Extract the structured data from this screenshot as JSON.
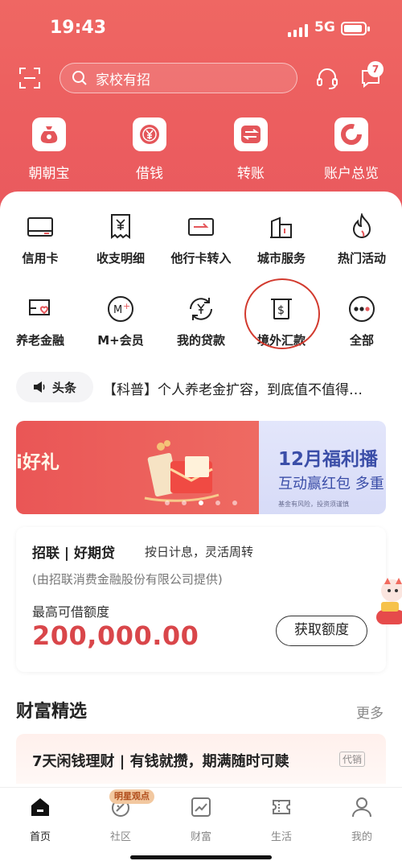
{
  "status": {
    "time": "19:43",
    "network": "5G"
  },
  "header": {
    "search_placeholder": "家校有招",
    "message_badge": "7"
  },
  "quick_actions": [
    {
      "label": "朝朝宝",
      "icon": "money-bag-icon"
    },
    {
      "label": "借钱",
      "icon": "yuan-coin-icon"
    },
    {
      "label": "转账",
      "icon": "transfer-arrows-icon"
    },
    {
      "label": "账户总览",
      "icon": "ring-chart-icon"
    }
  ],
  "services": [
    {
      "label": "信用卡",
      "icon": "credit-card-icon"
    },
    {
      "label": "收支明细",
      "icon": "receipt-icon"
    },
    {
      "label": "他行卡转入",
      "icon": "card-transfer-icon"
    },
    {
      "label": "城市服务",
      "icon": "city-building-icon"
    },
    {
      "label": "热门活动",
      "icon": "flame-icon"
    },
    {
      "label": "养老金融",
      "icon": "pension-card-icon"
    },
    {
      "label": "M+会员",
      "icon": "m-plus-icon"
    },
    {
      "label": "我的贷款",
      "icon": "loan-cycle-icon"
    },
    {
      "label": "境外汇款",
      "icon": "atm-dollar-icon"
    },
    {
      "label": "全部",
      "icon": "more-dots-icon"
    }
  ],
  "news": {
    "tag": "头条",
    "headline": "【科普】个人养老金扩容，到底值不值得…"
  },
  "banner": {
    "left_text": "i好礼",
    "right_title": "12月福利播",
    "right_sub": "互动赢红包 多重",
    "right_fine": "基金有风险，投资须谨慎",
    "active_dot": 3
  },
  "loan_card": {
    "title": "招联 | 好期贷",
    "subtitle": "按日计息，灵活周转",
    "note": "(由招联消费金融股份有限公司提供)",
    "amount_label": "最高可借额度",
    "amount": "200,000.00",
    "button": "获取额度"
  },
  "wealth": {
    "section_title": "财富精选",
    "more": "更多",
    "item_title": "7天闲钱理财 | 有钱就攒，期满随时可赎",
    "item_tag": "代销"
  },
  "tabbar": {
    "promo_pill": "明星观点",
    "tabs": [
      {
        "label": "首页",
        "icon": "home-icon"
      },
      {
        "label": "社区",
        "icon": "community-icon"
      },
      {
        "label": "财富",
        "icon": "chart-card-icon"
      },
      {
        "label": "生活",
        "icon": "ticket-icon"
      },
      {
        "label": "我的",
        "icon": "person-icon"
      }
    ]
  },
  "colors": {
    "brand_red": "#e8575e",
    "amount_red": "#d9464a",
    "circle_mark": "#d23a2e"
  }
}
